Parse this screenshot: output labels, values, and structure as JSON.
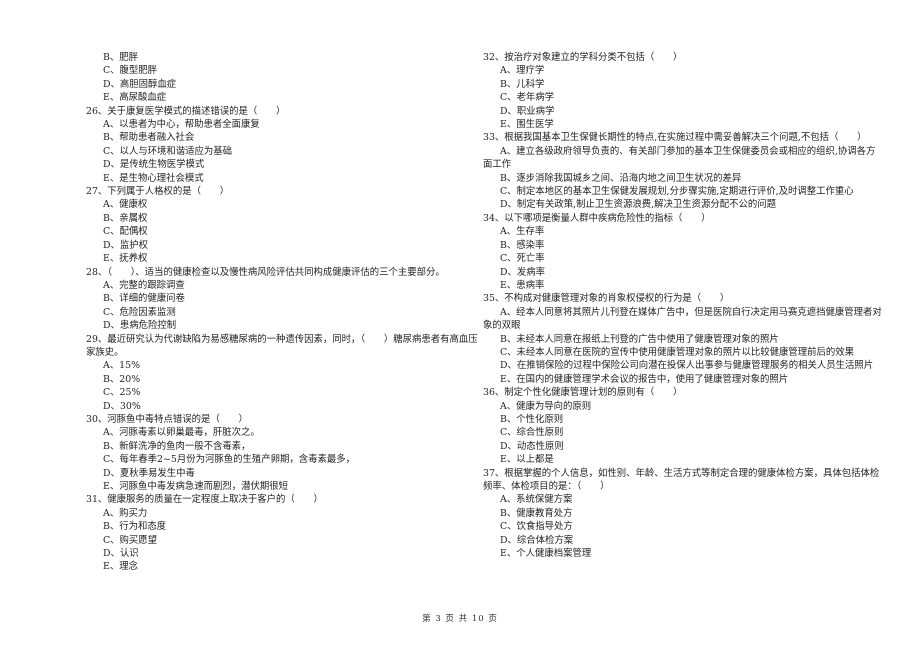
{
  "left_column": {
    "leading_options": [
      "B、肥胖",
      "C、腹型肥胖",
      "D、高胆固醇血症",
      "E、高尿酸血症"
    ],
    "questions": [
      {
        "stem": "26、关于康复医学模式的描述错误的是（　　）",
        "options": [
          "A、以患者为中心，帮助患者全面康复",
          "B、帮助患者融入社会",
          "C、以人与环境和谐适应为基础",
          "D、是传统生物医学模式",
          "E、是生物心理社会模式"
        ]
      },
      {
        "stem": "27、下列属于人格权的是（　　）",
        "options": [
          "A、健康权",
          "B、亲属权",
          "C、配偶权",
          "D、监护权",
          "E、抚养权"
        ]
      },
      {
        "stem": "28、（　　）、适当的健康检查以及慢性病风险评估共同构成健康评估的三个主要部分。",
        "options": [
          "A、完整的跟踪调查",
          "B、详细的健康问卷",
          "C、危险因素监测",
          "D、患病危险控制"
        ]
      },
      {
        "stem": "29、最近研究认为代谢缺陷为易感糖尿病的一种遗传因素，同时，（　　）糖尿病患者有高血压家族史。",
        "options": [
          "A、15%",
          "B、20%",
          "C、25%",
          "D、30%"
        ]
      },
      {
        "stem": "30、河豚鱼中毒特点错误的是（　　）",
        "options": [
          "A、河豚毒素以卵巢最毒，肝脏次之。",
          "B、新鲜洗净的鱼肉一般不含毒素，",
          "C、每年春季2~5月份为河豚鱼的生殖产卵期，含毒素最多，",
          "D、夏秋季易发生中毒",
          "E、河豚鱼中毒发病急速而剧烈，潜伏期很短"
        ]
      },
      {
        "stem": "31、健康服务的质量在一定程度上取决于客户的（　　）",
        "options": [
          "A、购买力",
          "B、行为和态度",
          "C、购买愿望",
          "D、认识",
          "E、理念"
        ]
      }
    ]
  },
  "right_column": {
    "questions": [
      {
        "stem": "32、按治疗对象建立的学科分类不包括（　　）",
        "options": [
          "A、理疗学",
          "B、儿科学",
          "C、老年病学",
          "D、职业病学",
          "E、围生医学"
        ]
      },
      {
        "stem": "33、根据我国基本卫生保健长期性的特点,在实施过程中需妥善解决三个问题,不包括（　　）",
        "options": [
          "A、建立各级政府领导负责的、有关部门参加的基本卫生保健委员会或相应的组织,协调各方面工作",
          "B、逐步消除我国城乡之间、沿海内地之间卫生状况的差异",
          "C、制定本地区的基本卫生保健发展规划,分步骤实施,定期进行评价,及时调整工作重心",
          "D、制定有关政策,制止卫生资源浪费,解决卫生资源分配不公的问题"
        ]
      },
      {
        "stem": "34、以下哪项是衡量人群中疾病危险性的指标（　　）",
        "options": [
          "A、生存率",
          "B、感染率",
          "C、死亡率",
          "D、发病率",
          "E、患病率"
        ]
      },
      {
        "stem": "35、不构成对健康管理对象的肖象权侵权的行为是（　　）",
        "options": [
          "A、经本人同意将其照片儿刊登在媒体广告中，但是医院自行决定用马赛克遮挡健康管理者对象的双眼",
          "B、未经本人同意在报纸上刊登的广告中使用了健康管理对象的照片",
          "C、未经本人同意在医院的宣传中使用健康管理对象的照片以比较健康管理前后的效果",
          "D、在推销保险的过程中保险公司向潜在投保人出事参与健康管理服务的相关人员生活照片",
          "E、在国内的健康管理学术会议的报告中，使用了健康管理对象的照片"
        ]
      },
      {
        "stem": "36、制定个性化健康管理计划的原则有（　　）",
        "options": [
          "A、健康为导向的原则",
          "B、个性化原则",
          "C、综合性原则",
          "D、动态性原则",
          "E、以上都是"
        ]
      },
      {
        "stem": "37、根据掌握的个人信息，如性别、年龄、生活方式等制定合理的健康体检方案，具体包括体检频率、体检项目的是：（　　）",
        "options": [
          "A、系统保健方案",
          "B、健康教育处方",
          "C、饮食指导处方",
          "D、综合体检方案",
          "E、个人健康档案管理"
        ]
      }
    ]
  },
  "footer": {
    "page_label": "第 3 页 共 10 页"
  }
}
